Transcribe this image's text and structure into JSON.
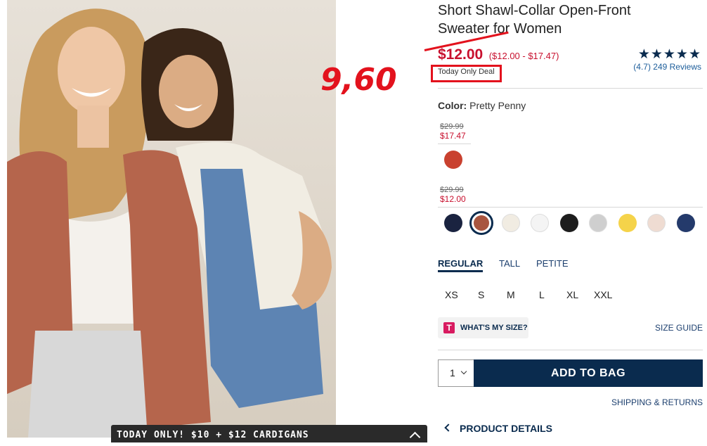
{
  "product": {
    "title_line1": "Short Shawl-Collar Open-Front",
    "title_line2": "Sweater for Women",
    "sale_price": "$12.00",
    "price_range": "($12.00 - $17.47)",
    "deal_label": "Today Only Deal",
    "rating_stars": "★★★★★",
    "rating_text": "(4.7) 249 Reviews",
    "annotation": "9,60"
  },
  "color": {
    "label": "Color:",
    "selected_name": "Pretty Penny",
    "group1": {
      "old_price": "$29.99",
      "new_price": "$17.47"
    },
    "group2": {
      "old_price": "$29.99",
      "new_price": "$12.00"
    },
    "group1_swatch": "#c9412f",
    "swatches": [
      "#1a2340",
      "#a8553f",
      "#f1ece2",
      "#f4f4f4",
      "#1d1d1d",
      "#cfcfcf",
      "#f5d34a",
      "#efdcd2",
      "#243a6b"
    ]
  },
  "fit": {
    "tabs": [
      "REGULAR",
      "TALL",
      "PETITE"
    ]
  },
  "sizes": [
    "XS",
    "S",
    "M",
    "L",
    "XL",
    "XXL"
  ],
  "size_help": {
    "whats_my_size": "WHAT'S MY SIZE?",
    "size_guide": "SIZE GUIDE",
    "logo": "T"
  },
  "cart": {
    "quantity": "1",
    "add_to_bag": "ADD TO BAG",
    "shipping_returns": "SHIPPING & RETURNS"
  },
  "details": {
    "label": "PRODUCT DETAILS"
  },
  "promo": {
    "banner": "TODAY ONLY! $10 + $12 CARDIGANS"
  },
  "accent_colors": {
    "navy": "#0a2b4e",
    "sale_red": "#c8102e",
    "annotation_red": "#e3121d"
  }
}
